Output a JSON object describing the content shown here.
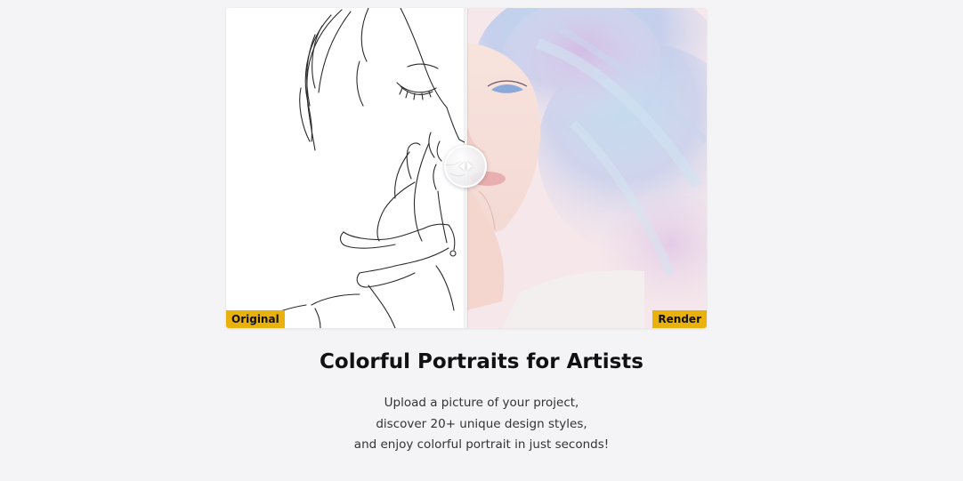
{
  "colors": {
    "background": "#f4f4f6",
    "label_badge": "#e8b10b",
    "title_text": "#111111",
    "body_text": "#333333"
  },
  "comparison": {
    "left_label": "Original",
    "right_label": "Render",
    "handle_icon": "left-right-arrows-icon",
    "split_position": 0.5
  },
  "feature": {
    "title": "Colorful Portraits for Artists",
    "description_lines": [
      "Upload a picture of your project,",
      "discover 20+ unique design styles,",
      "and enjoy colorful portrait in just seconds!"
    ]
  }
}
